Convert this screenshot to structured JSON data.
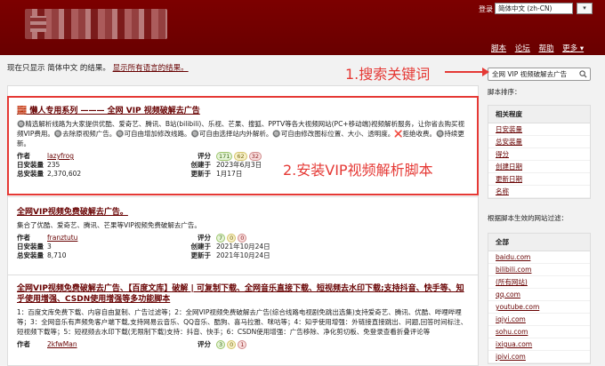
{
  "header": {
    "login": "登录",
    "lang": "简体中文 (zh-CN)",
    "go": "▾",
    "nav": [
      "脚本",
      "论坛",
      "帮助",
      "更多 ▾"
    ]
  },
  "filter": {
    "text": "现在只显示 简体中文 的结果。",
    "link": "显示所有语言的结果。"
  },
  "search": {
    "value": "全网 VIP 视频破解去广告"
  },
  "annotations": {
    "a1": "1.搜索关键词",
    "a2": "2.安装VIP视频解析脚本"
  },
  "scripts": [
    {
      "title": "🧱 懒人专用系列 ——— 全网 VIP 视频破解去广告",
      "desc": "🔘精选解析线路为大家提供优酷、爱奇艺、腾讯、B站(bilibili)、乐视、芒果、搜狐、PPTV等各大视频网站(PC+移动端)视频解析服务，让你省去购买视频VIP费用。🔘去除原视频广告。🔘可自由增加修改线路。🔘可自由选择站内外解析。🔘可自由修改图标位置、大小、透明度。❌拒绝收费。🔘持续更新。",
      "author_label": "作者",
      "author": "lazyfrog",
      "rating_label": "评分",
      "ratings": [
        "171",
        "62",
        "32"
      ],
      "daily_label": "日安装量",
      "daily": "235",
      "created_label": "创建于",
      "created": "2023年6月3日",
      "total_label": "总安装量",
      "total": "2,370,602",
      "updated_label": "更新于",
      "updated": "1月17日"
    },
    {
      "title": "全网VIP视频免费破解去广告。",
      "desc": "集合了优酷、爱奇艺、腾讯、芒果等VIP视频免费破解去广告。",
      "author_label": "作者",
      "author": "franztutu",
      "rating_label": "评分",
      "ratings": [
        "7",
        "0",
        "0"
      ],
      "daily_label": "日安装量",
      "daily": "3",
      "created_label": "创建于",
      "created": "2021年10月24日",
      "total_label": "总安装量",
      "total": "8,710",
      "updated_label": "更新于",
      "updated": "2021年10月24日"
    },
    {
      "title": "全网VIP视频免费破解去广告、【百度文库】破解 | 可复制下载、全网音乐直接下载、短视频去水印下载;支持抖音、快手等、知乎使用增强、CSDN使用增强等多功能脚本",
      "desc": "1：百度文库免费下载、内容自由复制、广告过滤等；2：全网VIP视频免费破解去广告(综合线路电视剧免跳出选集)支持爱奇艺、腾讯、优酷、哔哩哔哩等；3：全网音乐有声频免客户端下载,支持网易云音乐、QQ音乐、酷狗、喜马拉雅、咪咕等；4：知乎使用增强：外链接直接跳出、问题,回答时间标注、短视频下载等；5：短视频去水印下载(无限制下载)支持：抖音、快手；6：CSDN使用增强：广告移除、净化剪切板、免登录查看折叠评论等",
      "author_label": "作者",
      "author": "2kfwMan",
      "rating_label": "评分",
      "ratings": [
        "3",
        "0",
        "1"
      ]
    }
  ],
  "sidebar": {
    "sort_label": "脚本排序：",
    "sort_items": [
      "相关程度",
      "日安装量",
      "总安装量",
      "得分",
      "创建日期",
      "更新日期",
      "名称"
    ],
    "site_label": "根据脚本生效的网站过滤：",
    "sites": [
      "全部",
      "baidu.com",
      "bilibili.com",
      "(所有网站)",
      "qq.com",
      "youtube.com",
      "iqiyi.com",
      "sohu.com",
      "ixigua.com",
      "ipivi.com"
    ]
  },
  "colors": {
    "header": "#7c0000",
    "link": "#670000",
    "annotation": "#e53935"
  }
}
